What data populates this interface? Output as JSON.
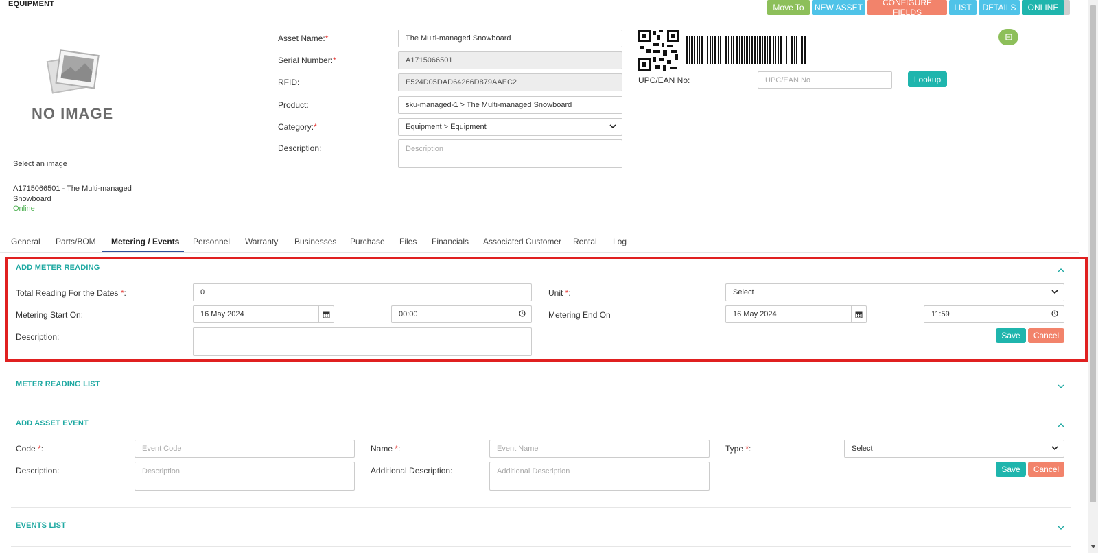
{
  "page": {
    "title": "EQUIPMENT"
  },
  "toolbar": {
    "move_to": "Move To",
    "new_asset": "NEW ASSET",
    "configure_fields": "CONFIGURE FIELDS",
    "list": "LIST",
    "details": "DETAILS",
    "online": "ONLINE"
  },
  "colors": {
    "green": "#8dbf5a",
    "blue": "#4fc3e8",
    "salmon": "#f2836b",
    "teal": "#1fb5ad",
    "red_highlight": "#e02020"
  },
  "image_panel": {
    "no_image": "NO IMAGE",
    "select_image": "Select an image",
    "caption": "A1715066501 - The Multi-managed Snowboard",
    "status": "Online"
  },
  "asset_form": {
    "asset_name_label": "Asset Name:",
    "asset_name_value": "The Multi-managed Snowboard",
    "serial_label": "Serial Number:",
    "serial_value": "A1715066501",
    "rfid_label": "RFID:",
    "rfid_value": "E524D05DAD64266D879AAEC2",
    "product_label": "Product:",
    "product_value": "sku-managed-1 > The Multi-managed Snowboard",
    "category_label": "Category:",
    "category_value": "Equipment > Equipment",
    "description_label": "Description:",
    "description_placeholder": "Description"
  },
  "upc": {
    "label": "UPC/EAN No:",
    "placeholder": "UPC/EAN No",
    "lookup": "Lookup"
  },
  "tabs": [
    {
      "label": "General"
    },
    {
      "label": "Parts/BOM"
    },
    {
      "label": "Metering / Events"
    },
    {
      "label": "Personnel"
    },
    {
      "label": "Warranty"
    },
    {
      "label": "Businesses"
    },
    {
      "label": "Purchase"
    },
    {
      "label": "Files"
    },
    {
      "label": "Financials"
    },
    {
      "label": "Associated Customer"
    },
    {
      "label": "Rental"
    },
    {
      "label": "Log"
    }
  ],
  "meter_reading": {
    "title": "ADD METER READING",
    "total_label": "Total Reading For the Dates",
    "total_value": "0",
    "unit_label": "Unit",
    "unit_value": "Select",
    "start_label": "Metering Start On:",
    "start_date": "16 May 2024",
    "start_time": "00:00",
    "end_label": "Metering End On",
    "end_date": "16 May 2024",
    "end_time": "11:59",
    "description_label": "Description:",
    "save": "Save",
    "cancel": "Cancel"
  },
  "meter_list": {
    "title": "METER READING LIST"
  },
  "asset_event": {
    "title": "ADD ASSET EVENT",
    "code_label": "Code",
    "code_placeholder": "Event Code",
    "name_label": "Name",
    "name_placeholder": "Event Name",
    "type_label": "Type",
    "type_value": "Select",
    "description_label": "Description:",
    "description_placeholder": "Description",
    "additional_label": "Additional Description:",
    "additional_placeholder": "Additional Description",
    "save": "Save",
    "cancel": "Cancel"
  },
  "events_list": {
    "title": "EVENTS LIST"
  },
  "required_mark": "*",
  "colon": ":"
}
